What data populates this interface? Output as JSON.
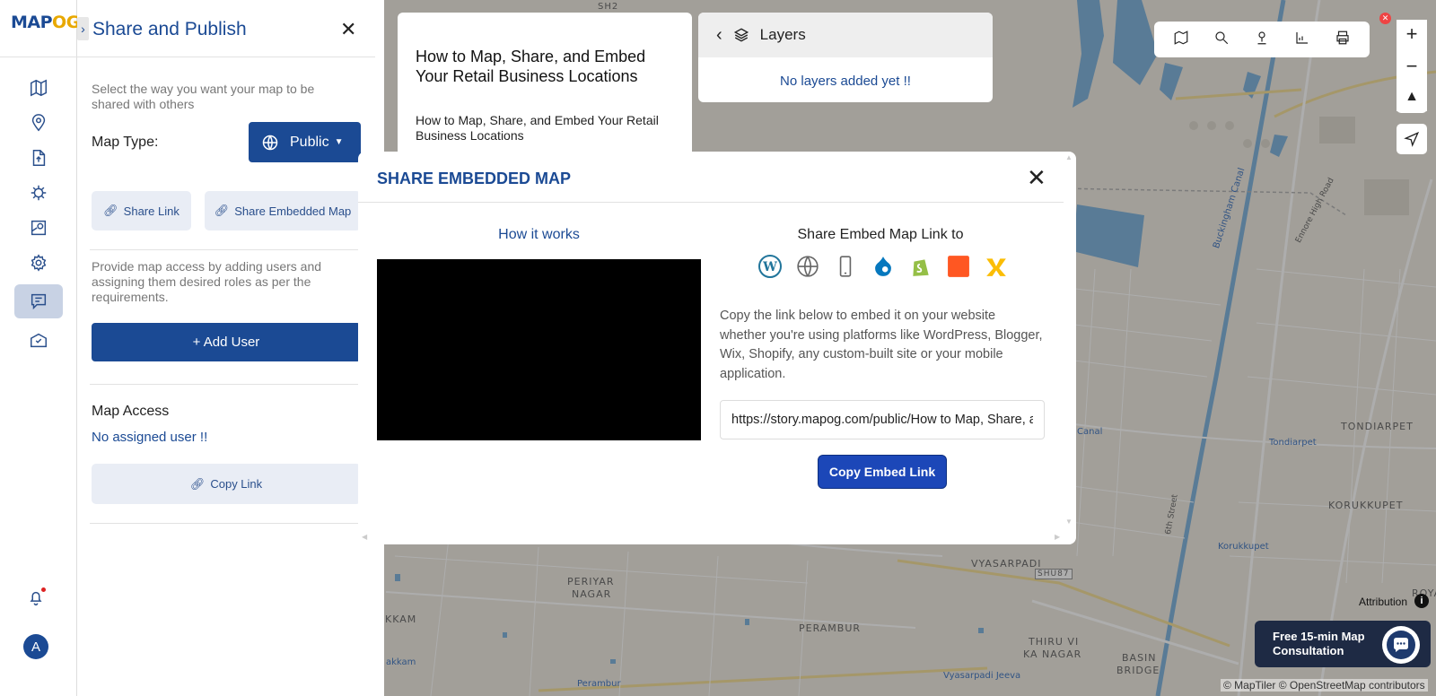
{
  "app": {
    "logo_main": "MAP",
    "logo_accent": "OG",
    "avatar_initial": "A"
  },
  "rail": {
    "icons": [
      "map-icon",
      "location-pin-icon",
      "upload-file-icon",
      "bug-icon",
      "map-pin-search-icon",
      "settings-icon",
      "share-publish-icon",
      "map-marker-check-icon"
    ],
    "active_index": 6
  },
  "panel": {
    "title": "Share and Publish",
    "share_description": "Select the way you want your map to be shared with others",
    "map_type_label": "Map Type:",
    "map_type_value": "Public",
    "share_link_label": "Share Link",
    "share_embedded_label": "Share Embedded Map",
    "access_description": "Provide map access by adding users and assigning them desired roles as per the requirements.",
    "add_user_label": "+ Add User",
    "map_access_title": "Map Access",
    "no_assigned_user": "No assigned user !!",
    "copy_link_label": "Copy Link"
  },
  "story": {
    "title": "How to Map, Share, and Embed Your Retail Business Locations",
    "subtitle": "How to Map, Share, and Embed Your Retail Business Locations"
  },
  "layers": {
    "title": "Layers",
    "empty_text": "No layers added yet !!"
  },
  "map": {
    "labels": {
      "sh2": "SH2",
      "tondiarpet_area": "TONDIARPET",
      "tondiarpet_station": "Tondiarpet",
      "korukkupet_area": "KORUKKUPET",
      "korukkupet_station": "Korukkupet",
      "vyasarpadi": "VYASARPADI",
      "shu87": "SHU87",
      "periyar_nagar_1": "PERIYAR",
      "periyar_nagar_2": "NAGAR",
      "perambur": "PERAMBUR",
      "thiru_vi_1": "THIRU VI",
      "thiru_vi_2": "KA NAGAR",
      "basin_1": "BASIN",
      "basin_2": "BRIDGE",
      "kkam": "KKAM",
      "akkam": "akkam",
      "perambur_loco": "Perambur",
      "vyasarpadi_jeeva": "Vyasarpadi Jeeva",
      "canal": "Buckingham Canal",
      "canal2": "Canal",
      "ennore": "Ennore High Road",
      "sixth_street": "6th Street",
      "roya": "ROYA"
    },
    "attribution": "Attribution",
    "copyright": "© MapTiler © OpenStreetMap contributors"
  },
  "consult": {
    "line1": "Free 15-min Map",
    "line2": "Consultation"
  },
  "modal": {
    "title": "SHARE EMBEDDED MAP",
    "how_it_works": "How it works",
    "share_to_title": "Share Embed Map Link to",
    "platforms": [
      "wordpress-icon",
      "globe-icon",
      "mobile-icon",
      "drupal-icon",
      "shopify-icon",
      "blogger-icon",
      "wix-icon"
    ],
    "description": "Copy the link below to embed it on your website whether you're using platforms like WordPress, Blogger, Wix, Shopify, any custom-built site or your mobile application.",
    "embed_url": "https://story.mapog.com/public/How to Map, Share, and Embed Your Retail Business Locations",
    "copy_button": "Copy Embed Link"
  },
  "colors": {
    "brand": "#1b4a94",
    "accent": "#e8a800",
    "copy_button": "#1c47b8",
    "water": "#6fa9d8"
  }
}
